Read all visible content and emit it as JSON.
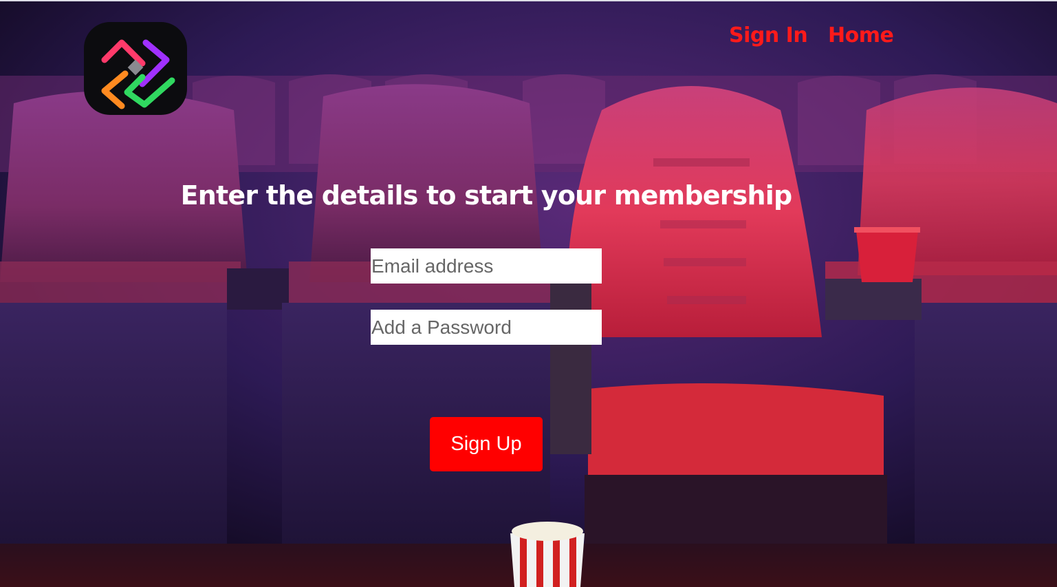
{
  "nav": {
    "sign_in_label": "Sign In",
    "home_label": "Home"
  },
  "hero": {
    "headline": "Enter the details to start your membership"
  },
  "form": {
    "email_placeholder": "Email address",
    "password_placeholder": "Add a Password",
    "signup_label": "Sign Up"
  },
  "icons": {
    "logo": "app-logo-icon",
    "background": "cinema-seats-image"
  },
  "colors": {
    "accent": "#ff0000",
    "nav_link": "#ff1a1a",
    "headline": "#ffffff"
  }
}
